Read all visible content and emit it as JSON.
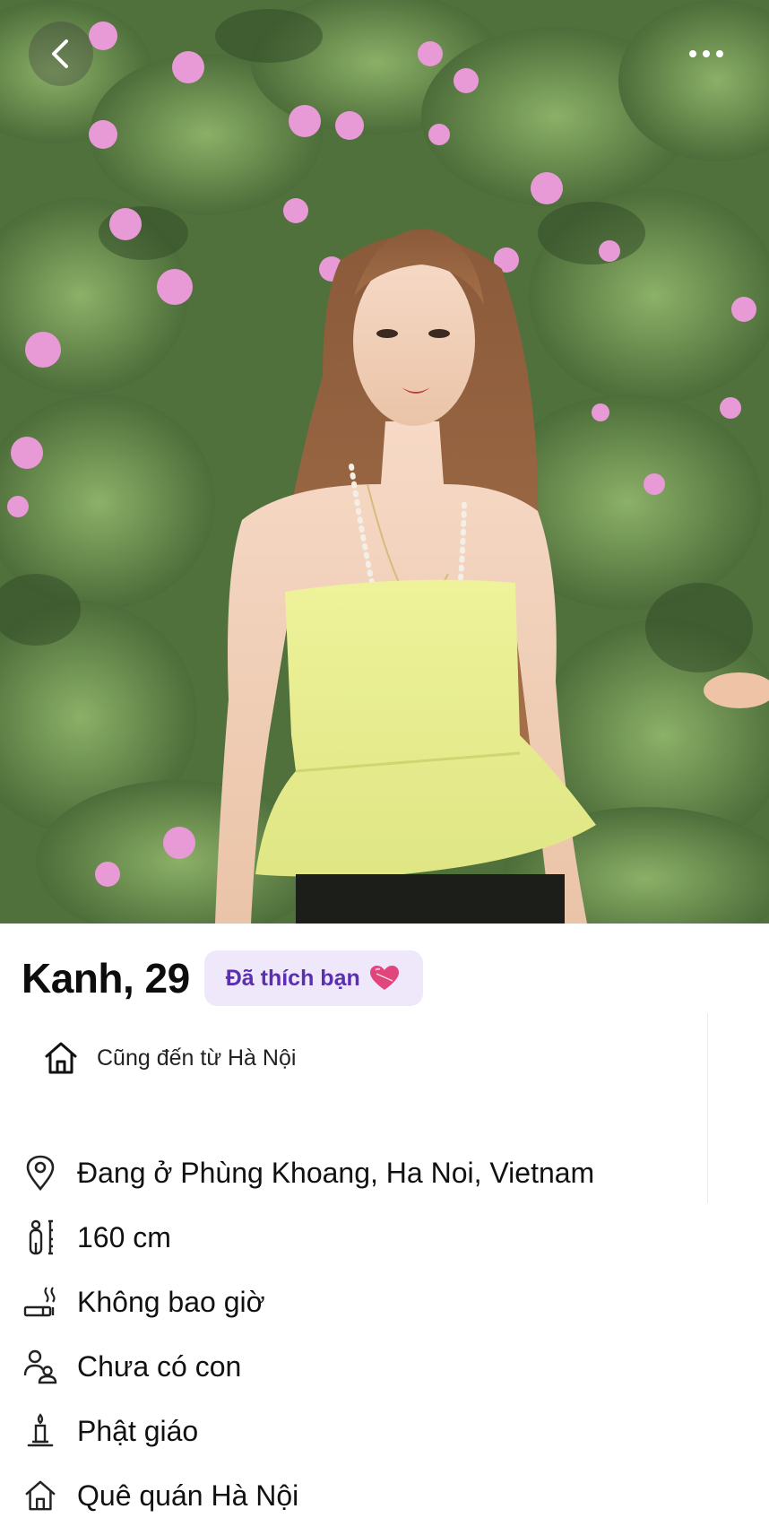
{
  "profile": {
    "name_age": "Kanh, 29",
    "liked_badge": "Đã thích bạn",
    "also_from": "Cũng đến từ Hà Nội",
    "details": [
      {
        "icon": "location-pin-icon",
        "text": "Đang ở Phùng Khoang, Ha Noi, Vietnam"
      },
      {
        "icon": "height-icon",
        "text": "160 cm"
      },
      {
        "icon": "smoking-icon",
        "text": "Không bao giờ"
      },
      {
        "icon": "children-icon",
        "text": "Chưa có con"
      },
      {
        "icon": "religion-candle-icon",
        "text": "Phật giáo"
      },
      {
        "icon": "home-icon",
        "text": "Quê quán Hà Nội"
      }
    ]
  },
  "icons": {
    "back": "chevron-left-icon",
    "more": "more-dots-icon",
    "heart": "heart-icon",
    "from": "home-icon"
  },
  "colors": {
    "badge_bg": "#efe8fb",
    "badge_text": "#5a2fb0",
    "heart": "#e0457b"
  }
}
